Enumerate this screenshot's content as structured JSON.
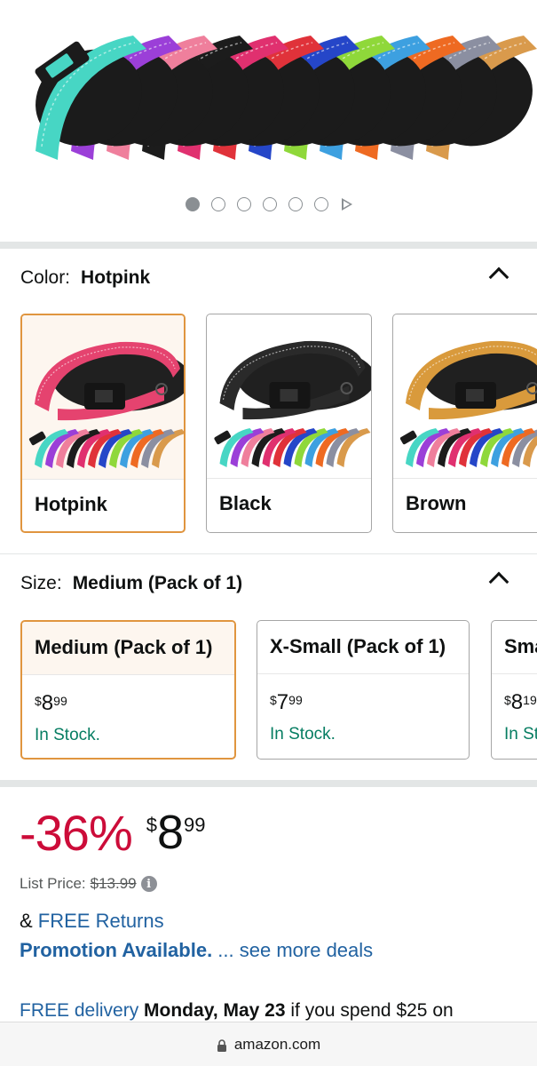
{
  "gallery": {
    "image_count": 6,
    "active_index": 0,
    "collar_colors": [
      "#47d6c4",
      "#9b3fd8",
      "#ef7f9c",
      "#1c1c1c",
      "#e0306f",
      "#e0323a",
      "#2546c8",
      "#8fd83a",
      "#3da0e0",
      "#ee6a22",
      "#8b8fa1",
      "#d99a4c"
    ]
  },
  "color": {
    "label": "Color:",
    "selected": "Hotpink",
    "options": [
      {
        "name": "Hotpink",
        "collar_color": "#e5436f"
      },
      {
        "name": "Black",
        "collar_color": "#2a2a2a"
      },
      {
        "name": "Brown",
        "collar_color": "#d99a3c"
      }
    ]
  },
  "size": {
    "label": "Size:",
    "selected": "Medium (Pack of 1)",
    "options": [
      {
        "name": "Medium (Pack of 1)",
        "price_sym": "$",
        "price_whole": "8",
        "price_cents": "99",
        "stock": "In Stock."
      },
      {
        "name": "X-Small (Pack of 1)",
        "price_sym": "$",
        "price_whole": "7",
        "price_cents": "99",
        "stock": "In Stock."
      },
      {
        "name": "Sma",
        "price_sym": "$",
        "price_whole": "8",
        "price_cents": "19",
        "stock": "In St"
      }
    ]
  },
  "pricing": {
    "discount": "-36%",
    "price_sym": "$",
    "price_whole": "8",
    "price_cents": "99",
    "list_price_label": "List Price:",
    "list_price": "$13.99"
  },
  "returns": {
    "prefix": "& ",
    "link": "FREE Returns"
  },
  "promo": {
    "bold": "Promotion Available.",
    "link": " ... see more deals"
  },
  "delivery": {
    "link": "FREE delivery",
    "date": " Monday, May 23",
    "suffix": " if you spend $25 on"
  },
  "browser": {
    "url": "amazon.com"
  },
  "colors": {
    "accent": "#e0953f",
    "discount": "#cc0c39",
    "link": "#2162a1",
    "stock": "#067d62"
  }
}
